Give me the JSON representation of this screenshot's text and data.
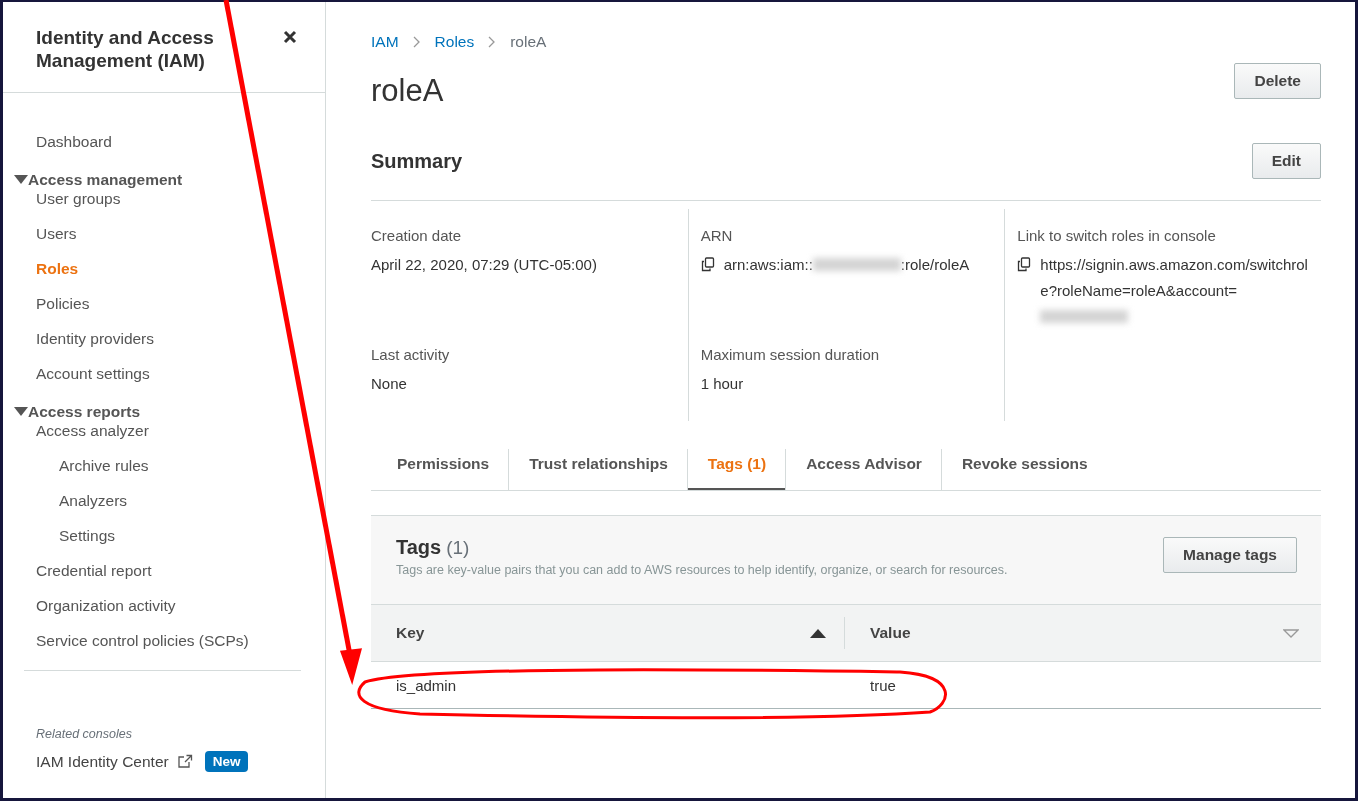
{
  "sidebar": {
    "title": "Identity and Access Management (IAM)",
    "nav": [
      {
        "kind": "link",
        "label": "Dashboard",
        "selected": false
      },
      {
        "kind": "group",
        "label": "Access management",
        "expanded": true,
        "children": [
          {
            "label": "User groups",
            "selected": false
          },
          {
            "label": "Users",
            "selected": false
          },
          {
            "label": "Roles",
            "selected": true
          },
          {
            "label": "Policies",
            "selected": false
          },
          {
            "label": "Identity providers",
            "selected": false
          },
          {
            "label": "Account settings",
            "selected": false
          }
        ]
      },
      {
        "kind": "group",
        "label": "Access reports",
        "expanded": true,
        "children": [
          {
            "label": "Access analyzer",
            "selected": false,
            "children": [
              {
                "label": "Archive rules",
                "selected": false
              },
              {
                "label": "Analyzers",
                "selected": false
              },
              {
                "label": "Settings",
                "selected": false
              }
            ]
          },
          {
            "label": "Credential report",
            "selected": false
          },
          {
            "label": "Organization activity",
            "selected": false
          },
          {
            "label": "Service control policies (SCPs)",
            "selected": false
          }
        ]
      }
    ],
    "related": {
      "heading": "Related consoles",
      "items": [
        {
          "label": "IAM Identity Center",
          "external": true,
          "badge": "New"
        }
      ]
    }
  },
  "breadcrumbs": [
    {
      "label": "IAM",
      "link": true
    },
    {
      "label": "Roles",
      "link": true
    },
    {
      "label": "roleA",
      "link": false
    }
  ],
  "page": {
    "title": "roleA",
    "button": "Delete"
  },
  "summary": {
    "heading": "Summary",
    "button": "Edit",
    "columns": [
      [
        {
          "label": "Creation date",
          "copyable": false,
          "value": [
            {
              "kind": "text",
              "text": "April 22, 2020, 07:29 (UTC-05:00)"
            }
          ]
        },
        {
          "label": "Last activity",
          "copyable": false,
          "value": [
            {
              "kind": "text",
              "text": "None"
            }
          ]
        }
      ],
      [
        {
          "label": "ARN",
          "copyable": true,
          "value": [
            {
              "kind": "text",
              "text": "arn:aws:iam::"
            },
            {
              "kind": "redacted"
            },
            {
              "kind": "text",
              "text": ":role/roleA"
            }
          ]
        },
        {
          "label": "Maximum session duration",
          "copyable": false,
          "value": [
            {
              "kind": "text",
              "text": "1 hour"
            }
          ]
        }
      ],
      [
        {
          "label": "Link to switch roles in console",
          "copyable": true,
          "value": [
            {
              "kind": "text",
              "text": "https://signin.aws.amazon.com/switchrole?roleName=roleA&account="
            },
            {
              "kind": "redacted"
            }
          ]
        }
      ]
    ]
  },
  "tabs": [
    {
      "label": "Permissions",
      "selected": false
    },
    {
      "label": "Trust relationships",
      "selected": false
    },
    {
      "label": "Tags (1)",
      "selected": true
    },
    {
      "label": "Access Advisor",
      "selected": false
    },
    {
      "label": "Revoke sessions",
      "selected": false
    }
  ],
  "tags": {
    "title": "Tags",
    "count": "(1)",
    "description": "Tags are key-value pairs that you can add to AWS resources to help identify, organize, or search for resources.",
    "button": "Manage tags",
    "columns": [
      {
        "label": "Key",
        "sorted": true
      },
      {
        "label": "Value",
        "sorted": false
      }
    ],
    "rows": [
      [
        "is_admin",
        "true"
      ]
    ]
  }
}
